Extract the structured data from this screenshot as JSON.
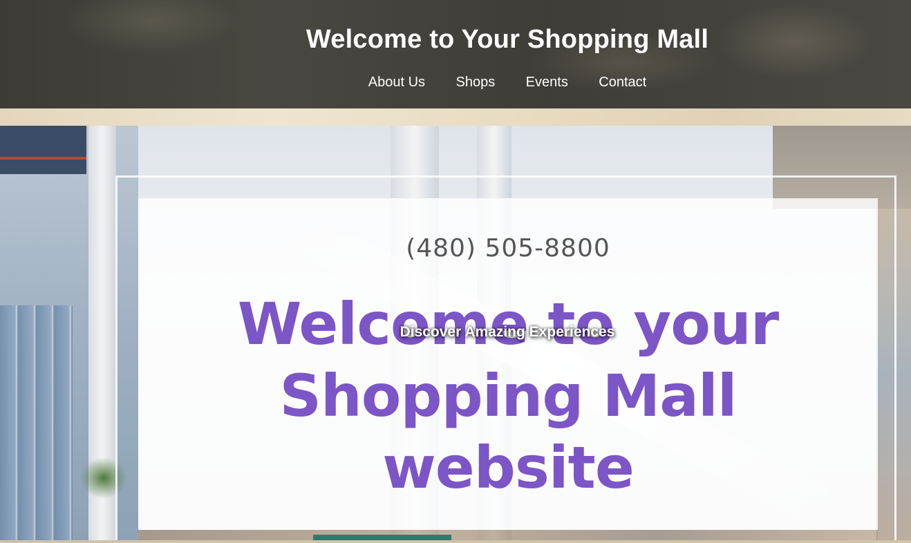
{
  "header": {
    "title": "Welcome to Your Shopping Mall",
    "nav": [
      {
        "label": "About Us"
      },
      {
        "label": "Shops"
      },
      {
        "label": "Events"
      },
      {
        "label": "Contact"
      }
    ]
  },
  "hero": {
    "phone": "(480) 505-8800",
    "heading_lines": [
      "Welcome to your",
      "Shopping Mall",
      "website"
    ],
    "tagline": "Discover Amazing Experiences",
    "heading_color": "#7c55c7"
  }
}
